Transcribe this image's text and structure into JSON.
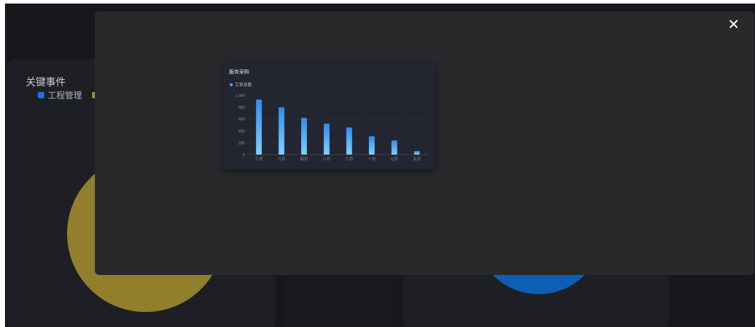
{
  "background": {
    "panel_title": "关键事件",
    "legend_item": "工程管理"
  },
  "modal": {
    "close_glyph": "✕",
    "chart_title": "服务采购",
    "legend_label": "工单总数"
  },
  "chart_data": {
    "type": "bar",
    "title": "服务采购",
    "categories": [
      "三月",
      "六月",
      "四月",
      "八月",
      "二月",
      "一月",
      "七月",
      "五月"
    ],
    "series": [
      {
        "name": "工单总数",
        "values": [
          930,
          800,
          620,
          525,
          460,
          310,
          240,
          60
        ]
      }
    ],
    "ylim": [
      0,
      1000
    ],
    "yticks": [
      "0",
      "200",
      "400",
      "600",
      "800",
      "1,000"
    ],
    "grid": true,
    "legend_position": "top-left",
    "bar_color": "#3ea3ff"
  }
}
